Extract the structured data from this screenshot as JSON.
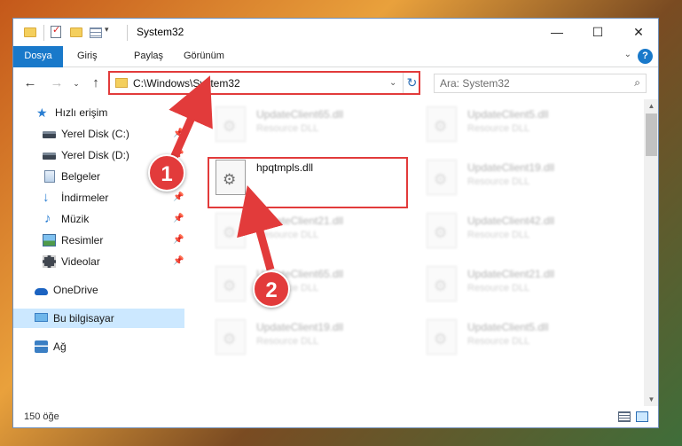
{
  "window": {
    "title": "System32",
    "controls": {
      "minimize": "—",
      "maximize": "☐",
      "close": "✕"
    }
  },
  "ribbon": {
    "tabs": [
      "Dosya",
      "Giriş",
      "Paylaş",
      "Görünüm"
    ],
    "help": "?"
  },
  "navigation": {
    "back": "←",
    "forward": "→",
    "recent": "⌄",
    "up": "↑",
    "address": "C:\\Windows\\System32",
    "refresh": "↻",
    "search_placeholder": "Ara: System32"
  },
  "sidebar": {
    "items": [
      {
        "label": "Hızlı erişim",
        "icon": "star-icon",
        "pinned": false
      },
      {
        "label": "Yerel Disk (C:)",
        "icon": "drive-icon",
        "pinned": true
      },
      {
        "label": "Yerel Disk (D:)",
        "icon": "drive-icon",
        "pinned": true
      },
      {
        "label": "Belgeler",
        "icon": "documents-icon",
        "pinned": true
      },
      {
        "label": "İndirmeler",
        "icon": "download-icon",
        "pinned": true
      },
      {
        "label": "Müzik",
        "icon": "music-icon",
        "pinned": true
      },
      {
        "label": "Resimler",
        "icon": "pictures-icon",
        "pinned": true
      },
      {
        "label": "Videolar",
        "icon": "videos-icon",
        "pinned": true
      },
      {
        "label": "OneDrive",
        "icon": "onedrive-icon",
        "pinned": false
      },
      {
        "label": "Bu bilgisayar",
        "icon": "this-pc-icon",
        "pinned": false,
        "selected": true
      },
      {
        "label": "Ağ",
        "icon": "network-icon",
        "pinned": false
      }
    ]
  },
  "files": {
    "highlighted": {
      "name": "hpqtmpls.dll",
      "type": ""
    },
    "blurred": [
      {
        "name": "UpdateClient65.dll",
        "type": "Resource DLL"
      },
      {
        "name": "UpdateClient5.dll",
        "type": "Resource DLL"
      },
      {
        "name": "UpdateClient19.dll",
        "type": "Resource DLL"
      },
      {
        "name": "UpdateClient21.dll",
        "type": "Resource DLL"
      },
      {
        "name": "UpdateClient42.dll",
        "type": "Resource DLL"
      },
      {
        "name": "UpdateClient65.dll",
        "type": "Resource DLL"
      },
      {
        "name": "UpdateClient21.dll",
        "type": "Resource DLL"
      },
      {
        "name": "UpdateClient19.dll",
        "type": "Resource DLL"
      },
      {
        "name": "UpdateClient5.dll",
        "type": "Resource DLL"
      }
    ]
  },
  "status": {
    "count_text": "150 öğe"
  },
  "annotations": {
    "step1": "1",
    "step2": "2",
    "color": "#e23b3b"
  }
}
